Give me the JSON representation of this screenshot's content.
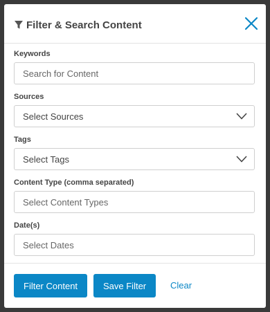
{
  "modal": {
    "title": "Filter & Search Content",
    "icons": {
      "title": "filter-icon",
      "close": "close-icon",
      "dropdown": "chevron-down-icon"
    },
    "accent_color": "#0b87c6"
  },
  "fields": {
    "keywords": {
      "label": "Keywords",
      "placeholder": "Search for Content",
      "value": ""
    },
    "sources": {
      "label": "Sources",
      "selected": "Select Sources"
    },
    "tags": {
      "label": "Tags",
      "selected": "Select Tags"
    },
    "content_type": {
      "label": "Content Type (comma separated)",
      "placeholder": "Select Content Types",
      "value": ""
    },
    "dates": {
      "label": "Date(s)",
      "placeholder": "Select Dates",
      "value": ""
    }
  },
  "actions": {
    "filter_label": "Filter Content",
    "save_label": "Save Filter",
    "clear_label": "Clear"
  }
}
